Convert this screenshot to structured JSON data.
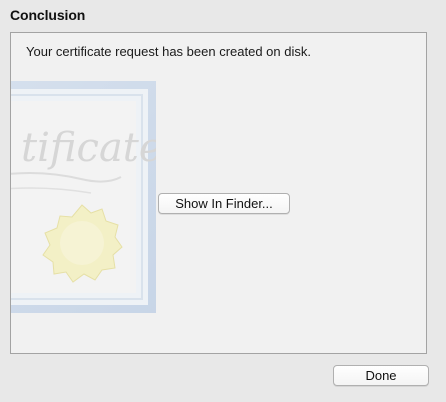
{
  "section": {
    "title": "Conclusion"
  },
  "panel": {
    "message": "Your certificate request has been created on disk.",
    "illustration": {
      "icon": "certificate-icon",
      "watermark_text": "Certificate"
    }
  },
  "buttons": {
    "show_in_finder": "Show In Finder...",
    "done": "Done"
  },
  "colors": {
    "background": "#e8e8e8",
    "panel_background": "#f1f1f1",
    "panel_border": "#a3a3a3",
    "certificate_frame": "#c8d6e8",
    "seal": "#f2efc4"
  }
}
